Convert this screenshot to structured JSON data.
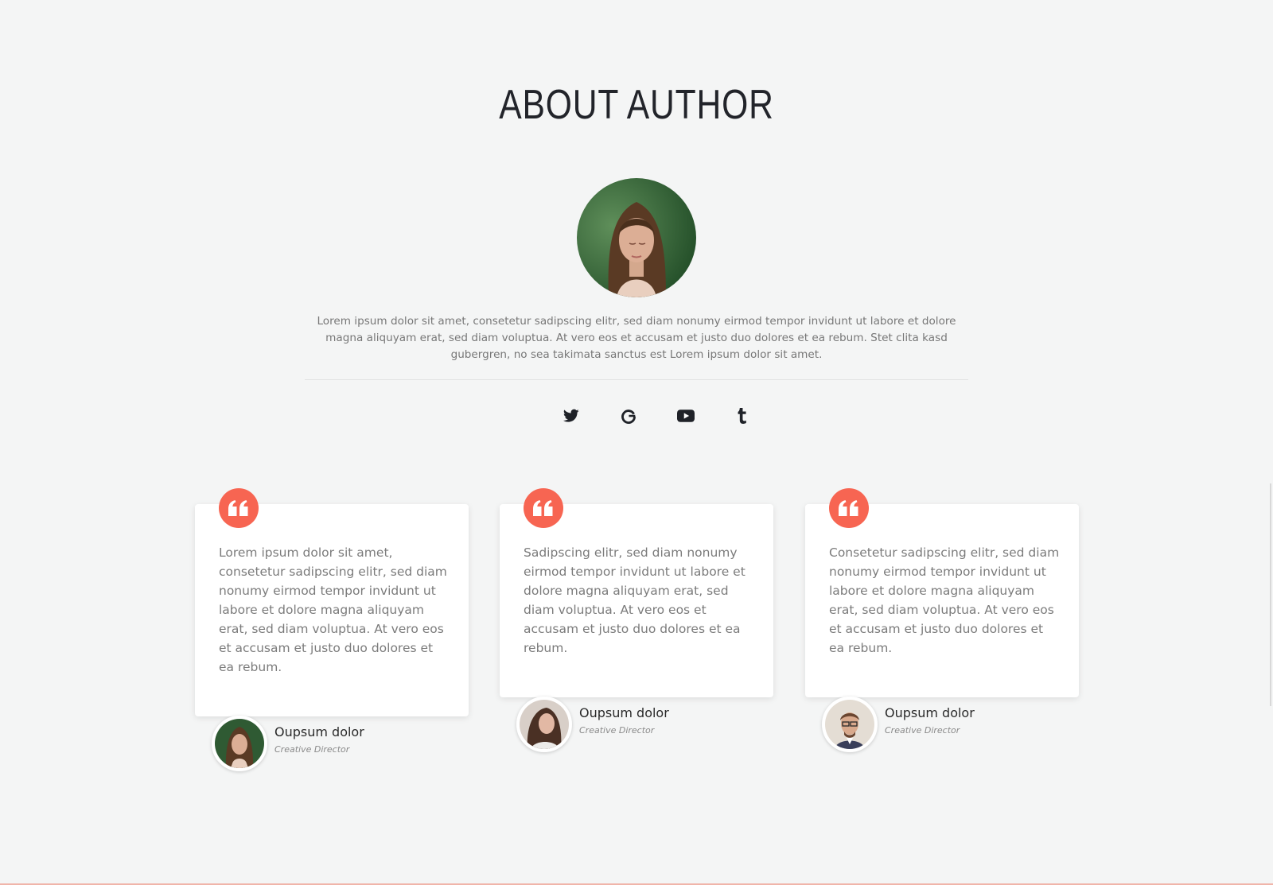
{
  "section": {
    "title": "ABOUT AUTHOR"
  },
  "author": {
    "bio": "Lorem ipsum dolor sit amet, consetetur sadipscing elitr, sed diam nonumy eirmod tempor invidunt ut labore et dolore magna aliquyam erat, sed diam voluptua. At vero eos et accusam et justo duo dolores et ea rebum. Stet clita kasd gubergren, no sea takimata sanctus est Lorem ipsum dolor sit amet."
  },
  "social": {
    "items": [
      {
        "icon": "twitter-icon"
      },
      {
        "icon": "google-icon"
      },
      {
        "icon": "youtube-icon"
      },
      {
        "icon": "tumblr-icon"
      }
    ]
  },
  "testimonials": [
    {
      "text": "Lorem ipsum dolor sit amet, consetetur sadipscing elitr, sed diam nonumy eirmod tempor invidunt ut labore et dolore magna aliquyam erat, sed diam voluptua. At vero eos et accusam et justo duo dolores et ea rebum.",
      "name": "Oupsum dolor",
      "role": "Creative Director"
    },
    {
      "text": "Sadipscing elitr, sed diam nonumy eirmod tempor invidunt ut labore et dolore magna aliquyam erat, sed diam voluptua. At vero eos et accusam et justo duo dolores et ea rebum.",
      "name": "Oupsum dolor",
      "role": "Creative Director"
    },
    {
      "text": "Consetetur sadipscing elitr, sed diam nonumy eirmod tempor invidunt ut labore et dolore magna aliquyam erat, sed diam voluptua. At vero eos et accusam et justo duo dolores et ea rebum.",
      "name": "Oupsum dolor",
      "role": "Creative Director"
    }
  ],
  "colors": {
    "accent": "#f76552",
    "background": "#f4f5f5",
    "heading": "#22242a",
    "body_text": "#7b7b7b"
  }
}
